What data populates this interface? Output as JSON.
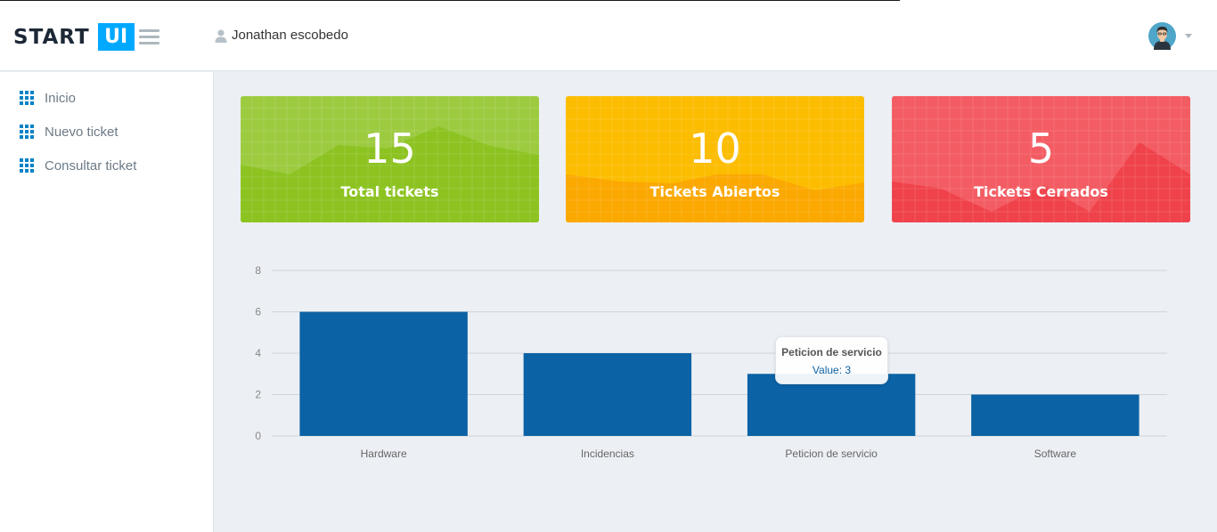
{
  "header": {
    "logo_start": "START",
    "logo_ui": "UI",
    "username": "Jonathan escobedo"
  },
  "sidebar": {
    "items": [
      {
        "label": "Inicio",
        "icon": "grid-icon"
      },
      {
        "label": "Nuevo ticket",
        "icon": "grid-icon"
      },
      {
        "label": "Consultar ticket",
        "icon": "grid-icon"
      }
    ]
  },
  "cards": [
    {
      "value": "15",
      "label": "Total tickets",
      "color": "#8cc321"
    },
    {
      "value": "10",
      "label": "Tickets Abiertos",
      "color": "#fbb100"
    },
    {
      "value": "5",
      "label": "Tickets Cerrados",
      "color": "#f24a52"
    }
  ],
  "tooltip": {
    "title": "Peticion de servicio",
    "value": "Value: 3"
  },
  "chart_data": {
    "type": "bar",
    "categories": [
      "Hardware",
      "Incidencias",
      "Peticion de servicio",
      "Software"
    ],
    "values": [
      6,
      4,
      3,
      2
    ],
    "ylim": [
      0,
      8
    ],
    "yticks": [
      "0",
      "2",
      "4",
      "6",
      "8"
    ],
    "grid": true,
    "bar_color": "#0b62a4"
  }
}
